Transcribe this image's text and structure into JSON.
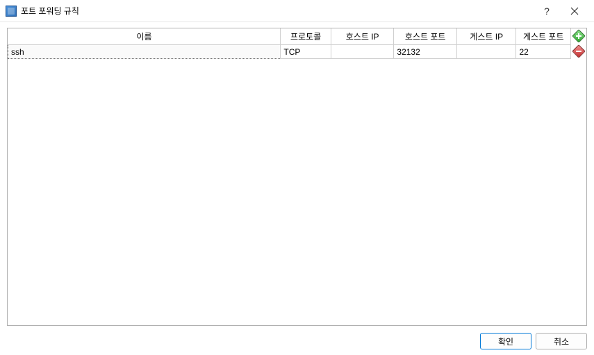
{
  "window": {
    "title": "포트 포워딩 규칙"
  },
  "table": {
    "headers": {
      "name": "이름",
      "protocol": "프로토콜",
      "host_ip": "호스트 IP",
      "host_port": "호스트 포트",
      "guest_ip": "게스트 IP",
      "guest_port": "게스트 포트"
    },
    "rows": [
      {
        "name": "ssh",
        "protocol": "TCP",
        "host_ip": "",
        "host_port": "32132",
        "guest_ip": "",
        "guest_port": "22"
      }
    ]
  },
  "buttons": {
    "ok": "확인",
    "cancel": "취소"
  }
}
